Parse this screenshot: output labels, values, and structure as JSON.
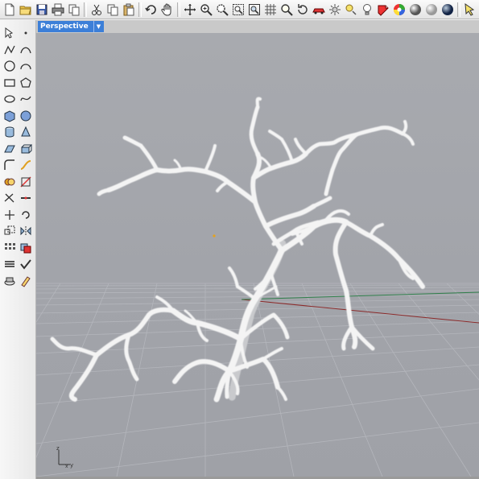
{
  "app": {
    "viewport_title": "Perspective",
    "viewport_menu_arrow": "▼"
  },
  "toolbar": {
    "items": [
      "new",
      "open",
      "save",
      "print",
      "copy-doc",
      "cut",
      "copy",
      "paste",
      "undo",
      "pan",
      "move",
      "zoom",
      "zoom-dynamic",
      "zoom-extents",
      "zoom-selected",
      "grid-snap",
      "render-car",
      "sun",
      "light-bulb",
      "material",
      "color-wheel",
      "sphere-grey",
      "sphere-white",
      "sphere-blue",
      "cursor"
    ]
  },
  "sidebar": {
    "tools": [
      "select",
      "point",
      "polyline",
      "curve",
      "circle",
      "arc",
      "rectangle",
      "polygon",
      "ellipse",
      "freeform",
      "box",
      "sphere",
      "cylinder",
      "cone",
      "surface",
      "extrude",
      "fillet",
      "blend",
      "boolean",
      "split",
      "trim",
      "join",
      "move",
      "rotate",
      "scale",
      "mirror",
      "array",
      "group",
      "layer",
      "check",
      "dimension",
      "paint"
    ]
  },
  "axis": {
    "x": "x",
    "y": "y",
    "z": "z"
  },
  "colors": {
    "viewport_top": "#a5a7ad",
    "viewport_bottom": "#9a9ca3",
    "grid": "#b3b5bb",
    "x_axis": "#8b2a2a",
    "y_axis": "#2f7f4a",
    "model": "#f4f4f4",
    "tab": "#3c7fd8",
    "cplane_origin": "#e6a21b"
  }
}
